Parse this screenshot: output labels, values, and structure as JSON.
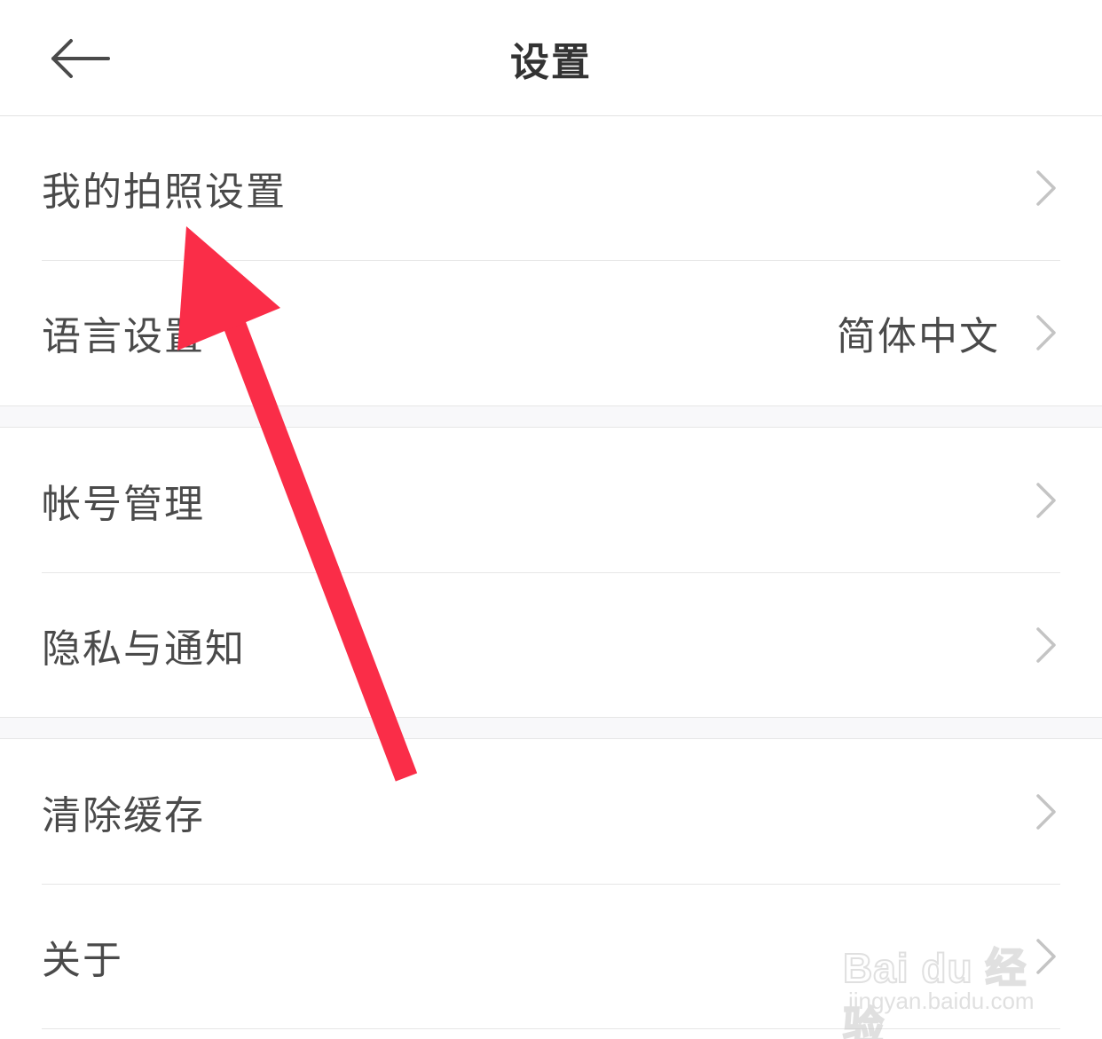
{
  "header": {
    "title": "设置",
    "back_icon": "back-arrow-icon"
  },
  "sections": [
    {
      "items": [
        {
          "label": "我的拍照设置",
          "value": ""
        },
        {
          "label": "语言设置",
          "value": "简体中文"
        }
      ]
    },
    {
      "items": [
        {
          "label": "帐号管理",
          "value": ""
        },
        {
          "label": "隐私与通知",
          "value": ""
        }
      ]
    },
    {
      "items": [
        {
          "label": "清除缓存",
          "value": ""
        },
        {
          "label": "关于",
          "value": ""
        }
      ]
    }
  ],
  "annotation": {
    "color": "#fa2d48"
  },
  "watermark": {
    "logo_text": "Bai du 经验",
    "url": "jingyan.baidu.com"
  }
}
